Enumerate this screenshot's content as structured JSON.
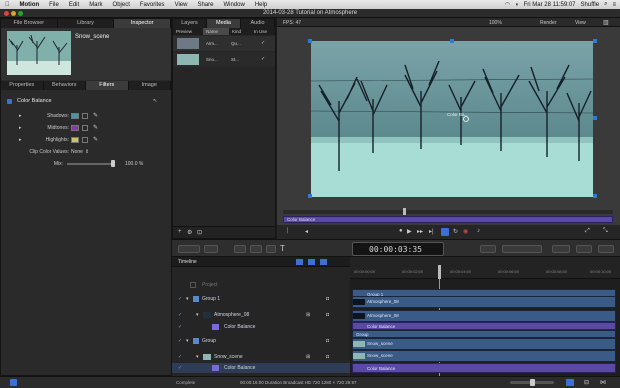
{
  "menubar": {
    "app": "Motion",
    "items": [
      "File",
      "Edit",
      "Mark",
      "Object",
      "Favorites",
      "View",
      "Share",
      "Window",
      "Help"
    ],
    "clock": "Fri Mar 28 11:59:07",
    "shuffle": "Shuffle"
  },
  "window": {
    "title": "2014-03-28 Tutorial on Atmosphere"
  },
  "left_tabs": [
    "File Browser",
    "Library",
    "Inspector"
  ],
  "left_preview_title": "Snow_scene",
  "inspector_tabs": [
    "Properties",
    "Behaviors",
    "Filters",
    "Image"
  ],
  "filters": {
    "section": "Color Balance",
    "rows": [
      "Shadows:",
      "Midtones:",
      "Highlights:"
    ],
    "clip_label": "Clip Color Values:",
    "clip_value": "None",
    "mix_label": "Mix:",
    "mix_value": "100.0 %"
  },
  "colors": {
    "shadows": "#3f9aa7",
    "midtones": "#8a3aa0",
    "highlights": "#c8c46a"
  },
  "mid_tabs": [
    "Layers",
    "Media",
    "Audio"
  ],
  "media_headers": [
    "Preview",
    "Name",
    "Kind",
    "In Use"
  ],
  "media_rows": [
    {
      "name": "Atm...",
      "kind": "Qu...",
      "check": "✓"
    },
    {
      "name": "Sno...",
      "kind": "St...",
      "check": "✓"
    }
  ],
  "canvas_bar": {
    "fps": "FPS: 47",
    "zoom": "100%",
    "render": "Render",
    "view": "View"
  },
  "canvas_handle_label": "Color Ba...",
  "mini_timeline_label": "Color Balance",
  "timecode": "00:00:03:35",
  "timeline": {
    "label": "Timeline",
    "ticks": [
      "00:00:00:00",
      "00:00:02:00",
      "00:00:04:00",
      "00:00:06:00",
      "00:00:08:00",
      "00:00:10:00"
    ],
    "layers": [
      {
        "name": "Project",
        "indent": 0
      },
      {
        "name": "Group 1",
        "indent": 0
      },
      {
        "name": "Atmosphere_08",
        "indent": 1
      },
      {
        "name": "Color Balance",
        "indent": 2
      },
      {
        "name": "Group",
        "indent": 0
      },
      {
        "name": "Snow_scene",
        "indent": 1
      },
      {
        "name": "Color Balance",
        "indent": 2
      }
    ],
    "tracks": [
      "Group 1",
      "Atmosphere_08",
      "Atmosphere_08",
      "Color Balance",
      "Group",
      "Snow_scene",
      "Snow_scene",
      "Color Balance"
    ]
  },
  "status": {
    "text": "00:00:16:00 Duration  Broadcast HD 720  1280 × 720  29.97",
    "left": "Complete"
  }
}
